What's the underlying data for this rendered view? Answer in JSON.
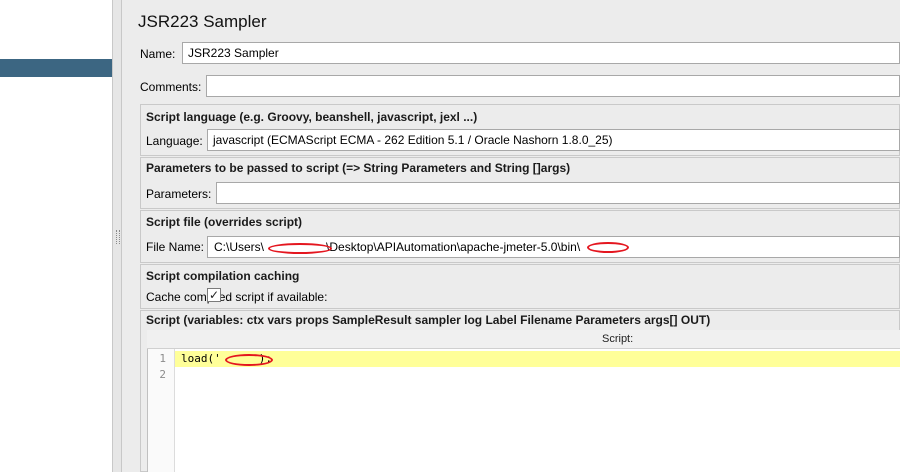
{
  "title": "JSR223 Sampler",
  "name": {
    "label": "Name:",
    "value": "JSR223 Sampler"
  },
  "comments": {
    "label": "Comments:",
    "value": ""
  },
  "script_language": {
    "section_title": "Script language (e.g. Groovy, beanshell, javascript, jexl ...)",
    "label": "Language:",
    "selected_value": "javascript     (ECMAScript ECMA - 262 Edition 5.1 / Oracle Nashorn 1.8.0_25)"
  },
  "parameters": {
    "section_title": "Parameters to be passed to script (=> String Parameters and String []args)",
    "label": "Parameters:",
    "value": ""
  },
  "script_file": {
    "section_title": "Script file (overrides script)",
    "label": "File Name:",
    "value_prefix": "C:\\Users\\",
    "value_middle": "\\Desktop\\APIAutomation\\apache-jmeter-5.0\\bin\\"
  },
  "caching": {
    "section_title": "Script compilation caching",
    "label": "Cache compiled script if available:",
    "checked": true,
    "check_glyph": "✓"
  },
  "script": {
    "section_title": "Script (variables: ctx vars props SampleResult sampler log Label Filename Parameters args[] OUT)",
    "header_label": "Script:",
    "line_numbers": [
      "1",
      "2"
    ],
    "lines": [
      "load('",
      ");",
      ""
    ]
  },
  "colors": {
    "tree_selection": "#3c6682",
    "current_line_highlight": "#ffff99",
    "redaction_scribble": "#e4161f"
  }
}
